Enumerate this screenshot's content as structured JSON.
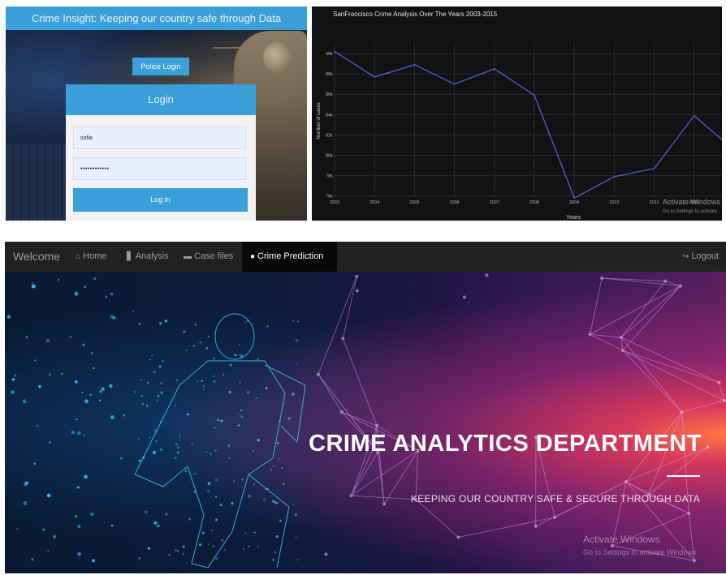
{
  "login_screen": {
    "title": "Crime Insight: Keeping our country safe through Data",
    "tab_label": "Police Login",
    "card_title": "Login",
    "username_value": "sofia",
    "password_value": "••••••••••••",
    "login_button": "Log in"
  },
  "chart_screen": {
    "watermark_line1": "Activate Windows",
    "watermark_line2": "Go to Settings to activate"
  },
  "chart_data": {
    "type": "line",
    "title": "SanFrancisco Crime Analysis Over The Years 2003-2015",
    "xlabel": "Years",
    "ylabel": "Number of cases",
    "x": [
      "2003",
      "2004",
      "2005",
      "2006",
      "2007",
      "2008",
      "2009",
      "2010",
      "2011",
      "2012",
      "2013"
    ],
    "values": [
      90200,
      87700,
      88900,
      87000,
      88500,
      85900,
      75800,
      77900,
      78700,
      83900,
      80500
    ],
    "y_ticks": [
      "76k",
      "78k",
      "80k",
      "82k",
      "84k",
      "86k",
      "88k",
      "90k"
    ],
    "x_tick_labels": [
      "2003",
      "2004",
      "2005",
      "2006",
      "2007",
      "2008",
      "2009",
      "2010",
      "2011",
      "2012"
    ],
    "ylim": [
      75500,
      91500
    ],
    "line_color": "#5b5fd6",
    "background": "#111111",
    "grid": true,
    "theme": "dark"
  },
  "website": {
    "brand": "Welcome",
    "nav": {
      "home": "Home",
      "analysis": "Analysis",
      "case_files": "Case files",
      "crime_prediction": "Crime Prediction",
      "logout": "Logout"
    },
    "active_tab": "Crime Prediction",
    "hero_title": "CRIME ANALYTICS DEPARTMENT",
    "hero_subtitle": "KEEPING OUR COUNTRY SAFE & SECURE THROUGH DATA",
    "watermark_line1": "Activate Windows",
    "watermark_line2": "Go to Settings to activate Windows"
  },
  "colors": {
    "login_accent": "#3b9fda",
    "navbar": "#222222",
    "navbar_active": "#080808",
    "hero_glow": "#ff7846"
  },
  "icons": {
    "home": "home-icon",
    "analysis": "bar-chart-icon",
    "case_files": "folder-open-icon",
    "crime_prediction": "globe-icon",
    "logout": "logout-icon"
  }
}
